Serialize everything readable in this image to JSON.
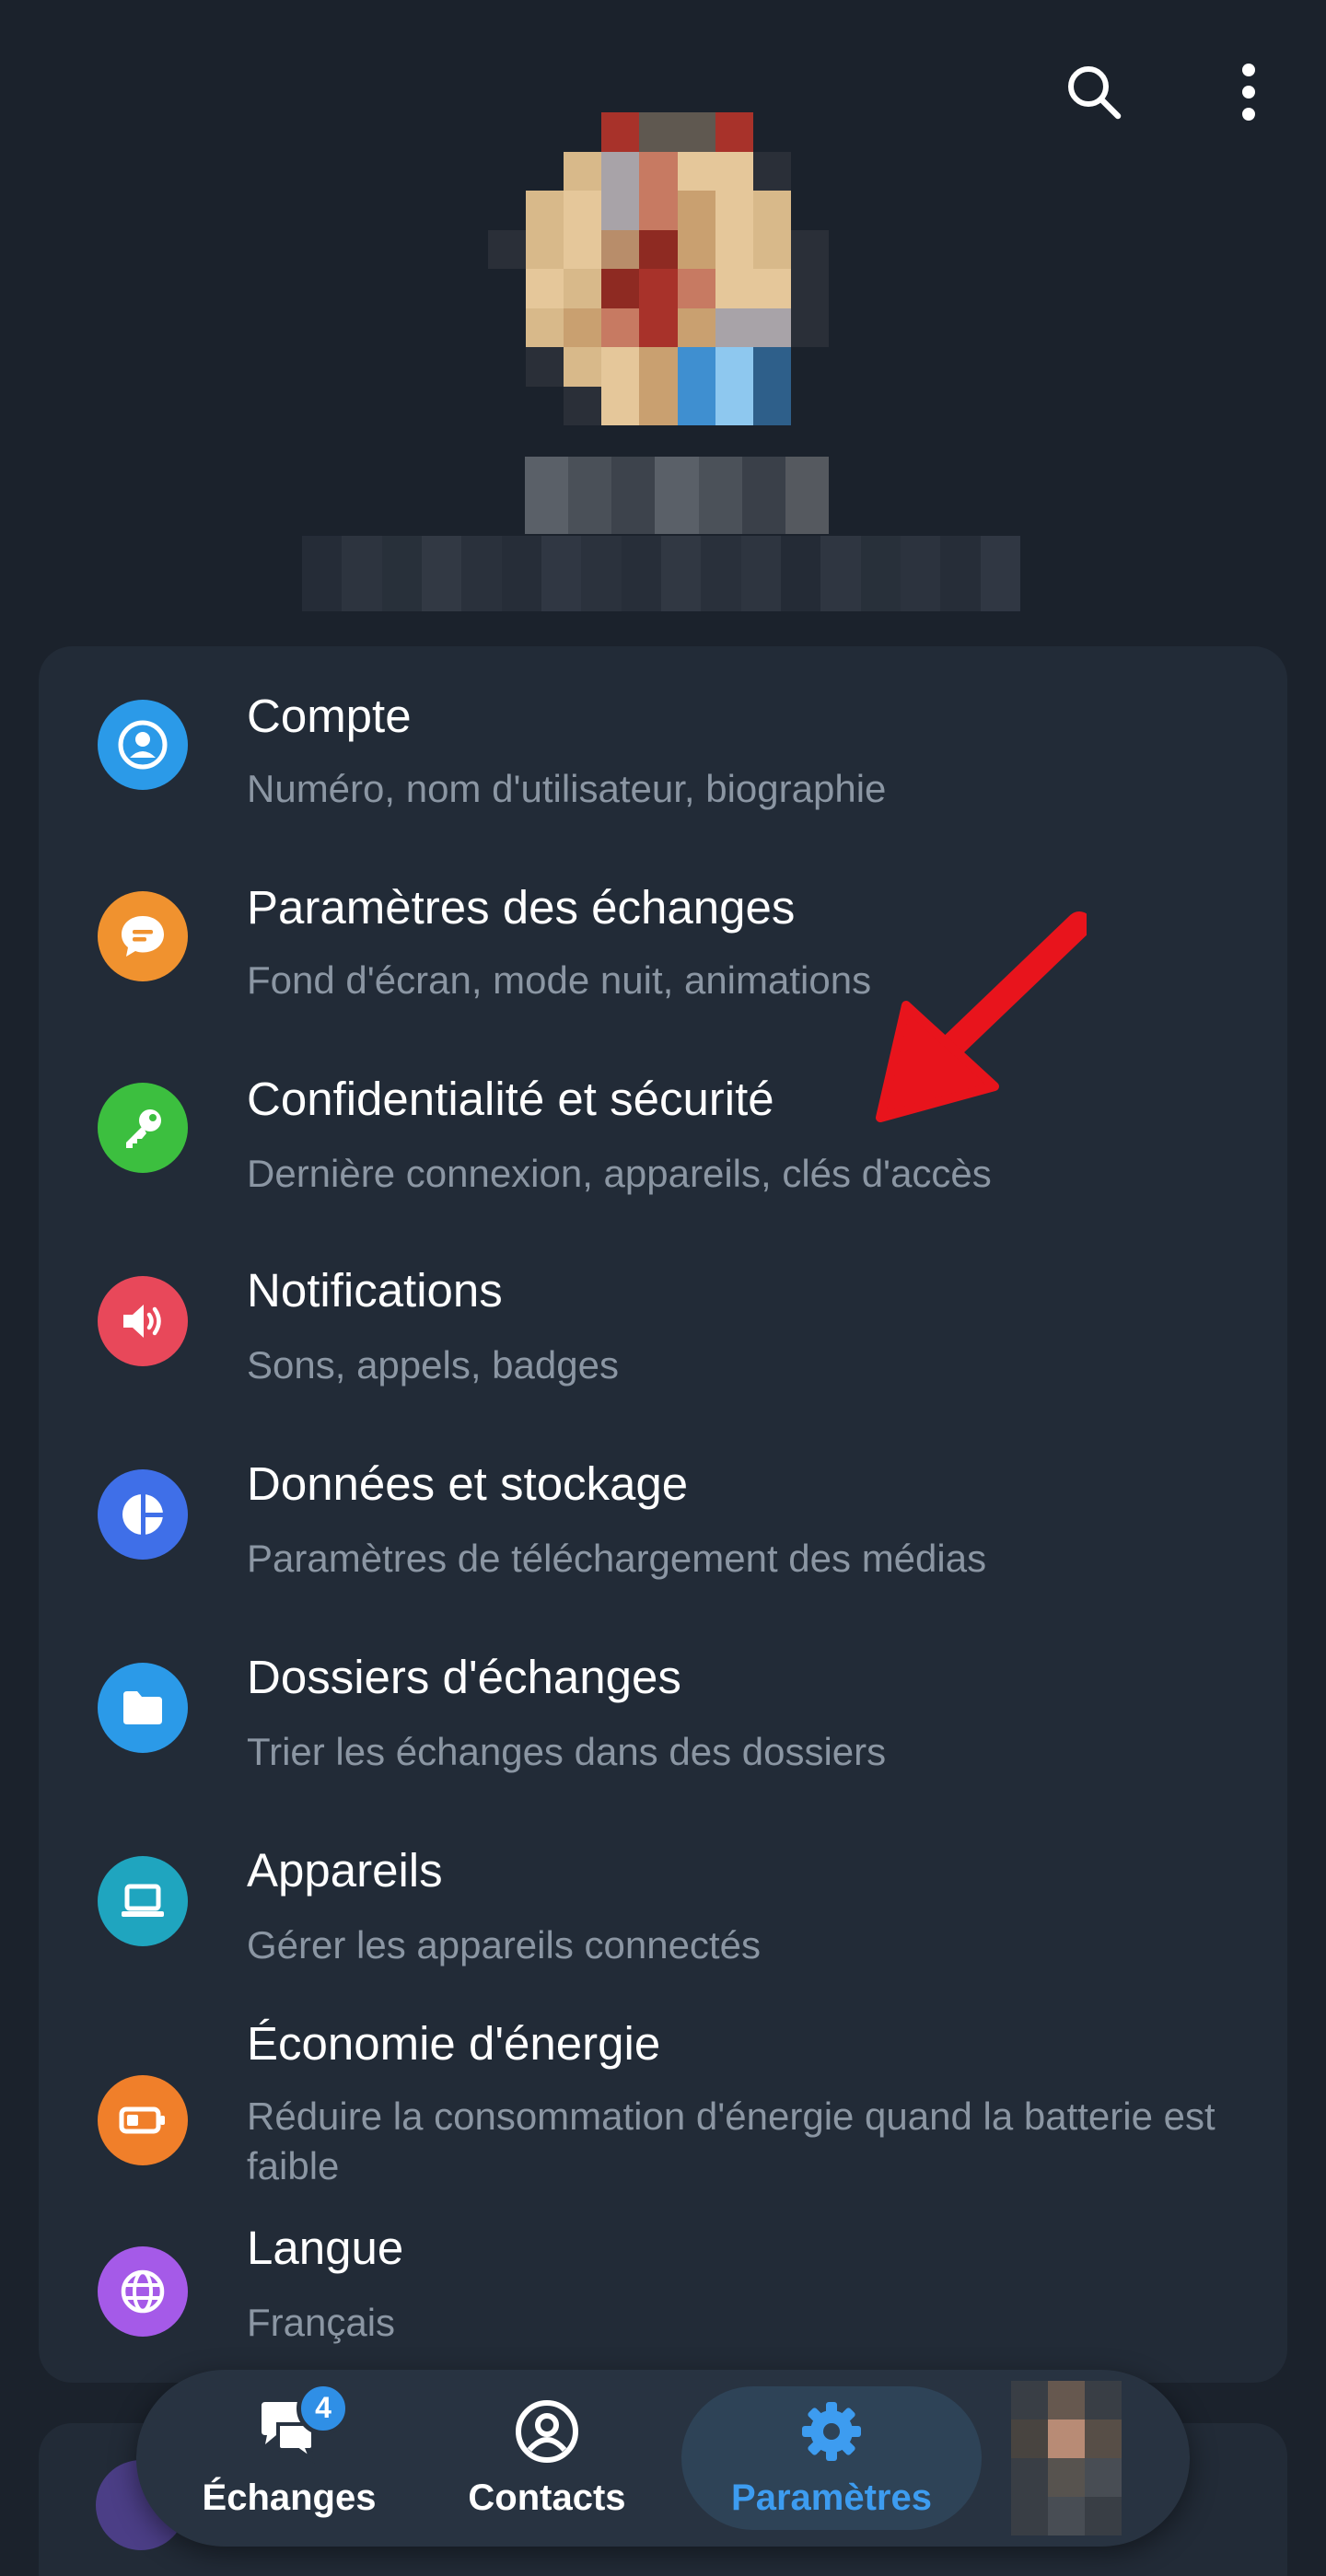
{
  "topbar": {
    "search_icon": "search-icon",
    "more_icon": "more-vertical-icon"
  },
  "profile": {
    "avatar_icon": "avatar"
  },
  "settings": {
    "items": [
      {
        "title": "Compte",
        "subtitle": "Numéro, nom d'utilisateur, biographie",
        "icon": "account-icon",
        "color": "#2b9ae8"
      },
      {
        "title": "Paramètres des échanges",
        "subtitle": "Fond d'écran, mode nuit, animations",
        "icon": "chat-bubble-icon",
        "color": "#f0922f"
      },
      {
        "title": "Confidentialité et sécurité",
        "subtitle": "Dernière connexion, appareils, clés d'accès",
        "icon": "key-icon",
        "color": "#3cbf3f"
      },
      {
        "title": "Notifications",
        "subtitle": "Sons, appels, badges",
        "icon": "speaker-icon",
        "color": "#e8485a"
      },
      {
        "title": "Données et stockage",
        "subtitle": "Paramètres de téléchargement des médias",
        "icon": "pie-chart-icon",
        "color": "#3f6fe8"
      },
      {
        "title": "Dossiers d'échanges",
        "subtitle": "Trier les échanges dans des dossiers",
        "icon": "folder-icon",
        "color": "#2b9ae8"
      },
      {
        "title": "Appareils",
        "subtitle": "Gérer les appareils connectés",
        "icon": "laptop-icon",
        "color": "#1fa5bf"
      },
      {
        "title": "Économie d'énergie",
        "subtitle": "Réduire la consommation d'énergie quand la batterie est faible",
        "icon": "battery-icon",
        "color": "#f07f2a"
      },
      {
        "title": "Langue",
        "subtitle": "Français",
        "icon": "globe-icon",
        "color": "#a55ae8"
      }
    ]
  },
  "annotation": {
    "arrow_color": "#e8141c"
  },
  "nav": {
    "chats_label": "Échanges",
    "chats_badge": "4",
    "contacts_label": "Contacts",
    "settings_label": "Paramètres",
    "accent": "#3d9cf0"
  }
}
